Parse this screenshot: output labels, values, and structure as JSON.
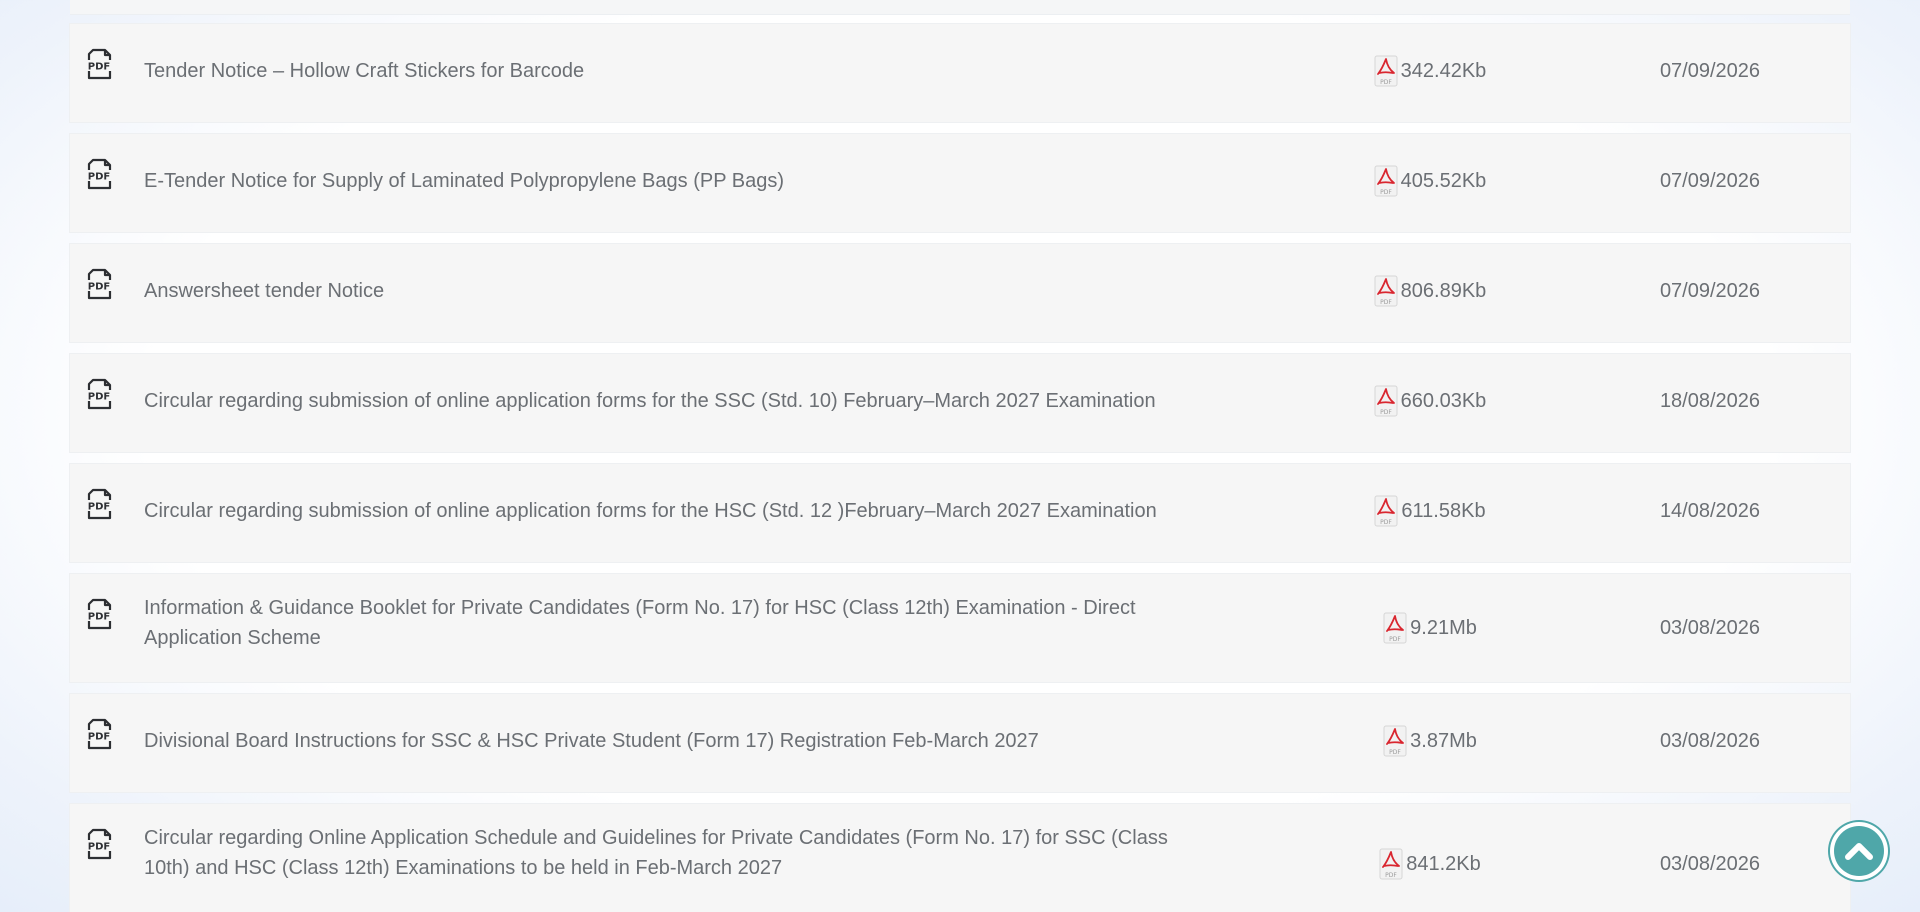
{
  "documents": [
    {
      "title": "Tender Notice – Hollow Craft Stickers for Barcode",
      "size": "342.42Kb",
      "date": "07/09/2026"
    },
    {
      "title": "E-Tender Notice for Supply of Laminated Polypropylene Bags (PP Bags)",
      "size": "405.52Kb",
      "date": "07/09/2026"
    },
    {
      "title": "Answersheet tender Notice",
      "size": "806.89Kb",
      "date": "07/09/2026"
    },
    {
      "title": "Circular regarding submission of online application forms for the SSC (Std. 10) February–March 2027 Examination",
      "size": "660.03Kb",
      "date": "18/08/2026"
    },
    {
      "title": "Circular regarding submission of online application forms for the HSC (Std. 12 )February–March 2027 Examination",
      "size": "611.58Kb",
      "date": "14/08/2026"
    },
    {
      "title": "Information & Guidance Booklet for Private Candidates (Form No. 17) for HSC (Class 12th) Examination - Direct Application Scheme",
      "size": "9.21Mb",
      "date": "03/08/2026"
    },
    {
      "title": "Divisional Board Instructions for SSC & HSC Private Student (Form 17) Registration Feb-March 2027",
      "size": "3.87Mb",
      "date": "03/08/2026"
    },
    {
      "title": "Circular regarding Online Application Schedule and Guidelines for Private Candidates (Form No. 17) for SSC (Class 10th) and HSC (Class 12th) Examinations to be held in Feb-March 2027",
      "size": "841.2Kb",
      "date": "03/08/2026"
    }
  ],
  "icons": {
    "row_icon": "pdf-document-icon",
    "size_icon": "acrobat-pdf-icon",
    "scroll_top": "chevron-up-icon"
  },
  "colors": {
    "row_background": "#f6f6f6",
    "text": "#6b6f74",
    "pdf_red": "#d9262f",
    "scroll_button": "#4fa7a9"
  }
}
